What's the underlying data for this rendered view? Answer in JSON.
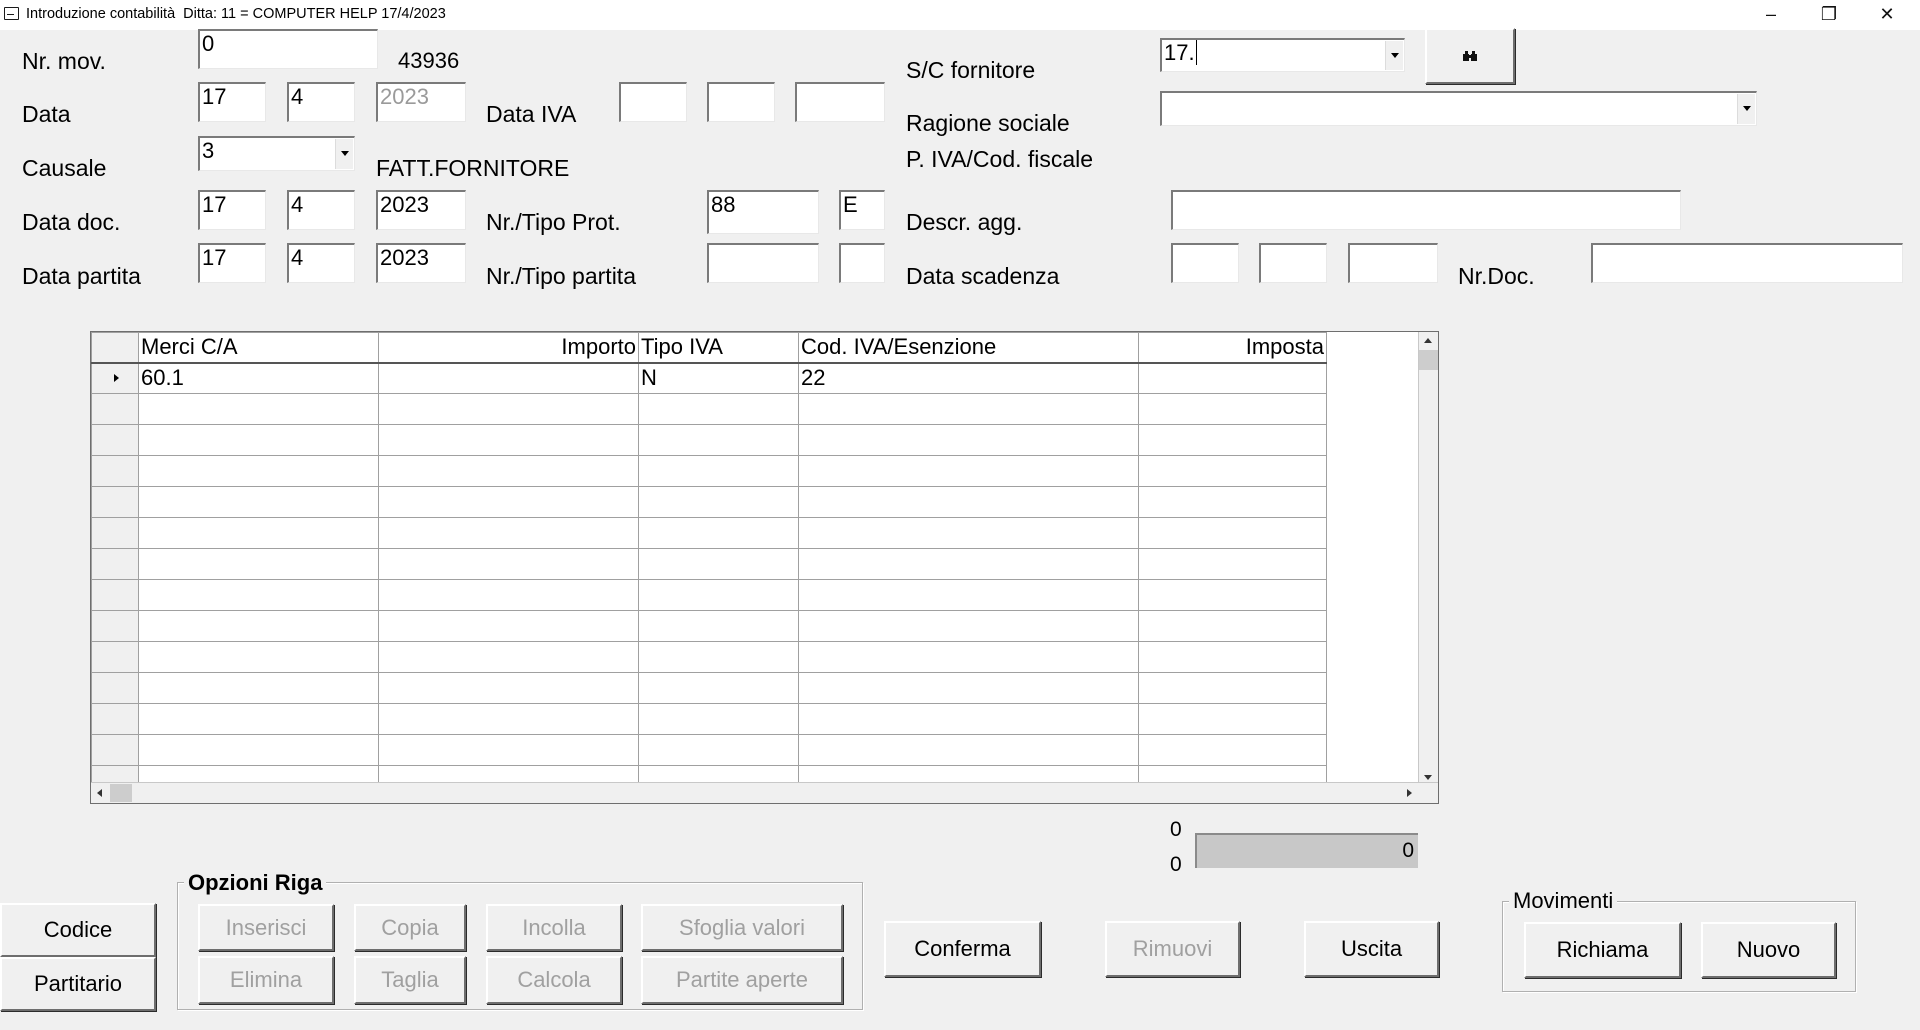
{
  "window": {
    "title": "Introduzione contabilità  Ditta: 11 = COMPUTER HELP 17/4/2023",
    "minimize_icon": "minimize-icon",
    "restore_icon": "restore-icon",
    "close_icon": "close-icon"
  },
  "form": {
    "nr_mov": {
      "label": "Nr. mov.",
      "value": "0",
      "counter": "43936"
    },
    "data": {
      "label": "Data",
      "day": "17",
      "month": "4",
      "year": "2023"
    },
    "data_iva": {
      "label": "Data IVA",
      "day": "",
      "month": "",
      "year": ""
    },
    "causale": {
      "label": "Causale",
      "value": "3",
      "description": "FATT.FORNITORE"
    },
    "data_doc": {
      "label": "Data doc.",
      "day": "17",
      "month": "4",
      "year": "2023"
    },
    "nr_tipo_prot": {
      "label": "Nr./Tipo Prot.",
      "number": "88",
      "type": "E"
    },
    "data_partita": {
      "label": "Data partita",
      "day": "17",
      "month": "4",
      "year": "2023"
    },
    "nr_tipo_partita": {
      "label": "Nr./Tipo partita",
      "number": "",
      "type": ""
    },
    "sc_fornitore": {
      "label": "S/C fornitore",
      "value": "17.",
      "search_icon": "binoculars-icon"
    },
    "ragione_sociale": {
      "label": "Ragione sociale",
      "value": ""
    },
    "piva": {
      "label": "P. IVA/Cod. fiscale"
    },
    "descr_agg": {
      "label": "Descr. agg.",
      "value": ""
    },
    "data_scadenza": {
      "label": "Data scadenza",
      "day": "",
      "month": "",
      "year": ""
    },
    "nr_doc": {
      "label": "Nr.Doc.",
      "value": ""
    }
  },
  "grid": {
    "columns": [
      "Merci C/A",
      "Importo",
      "Tipo IVA",
      "Cod. IVA/Esenzione",
      "Imposta"
    ],
    "rows": [
      [
        "60.1",
        "",
        "N",
        "22",
        ""
      ],
      [
        "",
        "",
        "",
        "",
        ""
      ],
      [
        "",
        "",
        "",
        "",
        ""
      ],
      [
        "",
        "",
        "",
        "",
        ""
      ],
      [
        "",
        "",
        "",
        "",
        ""
      ],
      [
        "",
        "",
        "",
        "",
        ""
      ],
      [
        "",
        "",
        "",
        "",
        ""
      ],
      [
        "",
        "",
        "",
        "",
        ""
      ],
      [
        "",
        "",
        "",
        "",
        ""
      ],
      [
        "",
        "",
        "",
        "",
        ""
      ],
      [
        "",
        "",
        "",
        "",
        ""
      ],
      [
        "",
        "",
        "",
        "",
        ""
      ],
      [
        "",
        "",
        "",
        "",
        ""
      ],
      [
        "",
        "",
        "",
        "",
        ""
      ]
    ],
    "current_row_icon": "row-pointer-icon"
  },
  "totals": {
    "top": "0",
    "bottom": "0",
    "box_value": "0"
  },
  "buttons": {
    "codice": "Codice",
    "partitario": "Partitario",
    "conferma": "Conferma",
    "rimuovi": "Rimuovi",
    "uscita": "Uscita"
  },
  "opzioni_riga": {
    "title": "Opzioni Riga",
    "inserisci": "Inserisci",
    "copia": "Copia",
    "incolla": "Incolla",
    "sfoglia_valori": "Sfoglia valori",
    "elimina": "Elimina",
    "taglia": "Taglia",
    "calcola": "Calcola",
    "partite_aperte": "Partite aperte"
  },
  "movimenti": {
    "title": "Movimenti",
    "richiama": "Richiama",
    "nuovo": "Nuovo"
  }
}
